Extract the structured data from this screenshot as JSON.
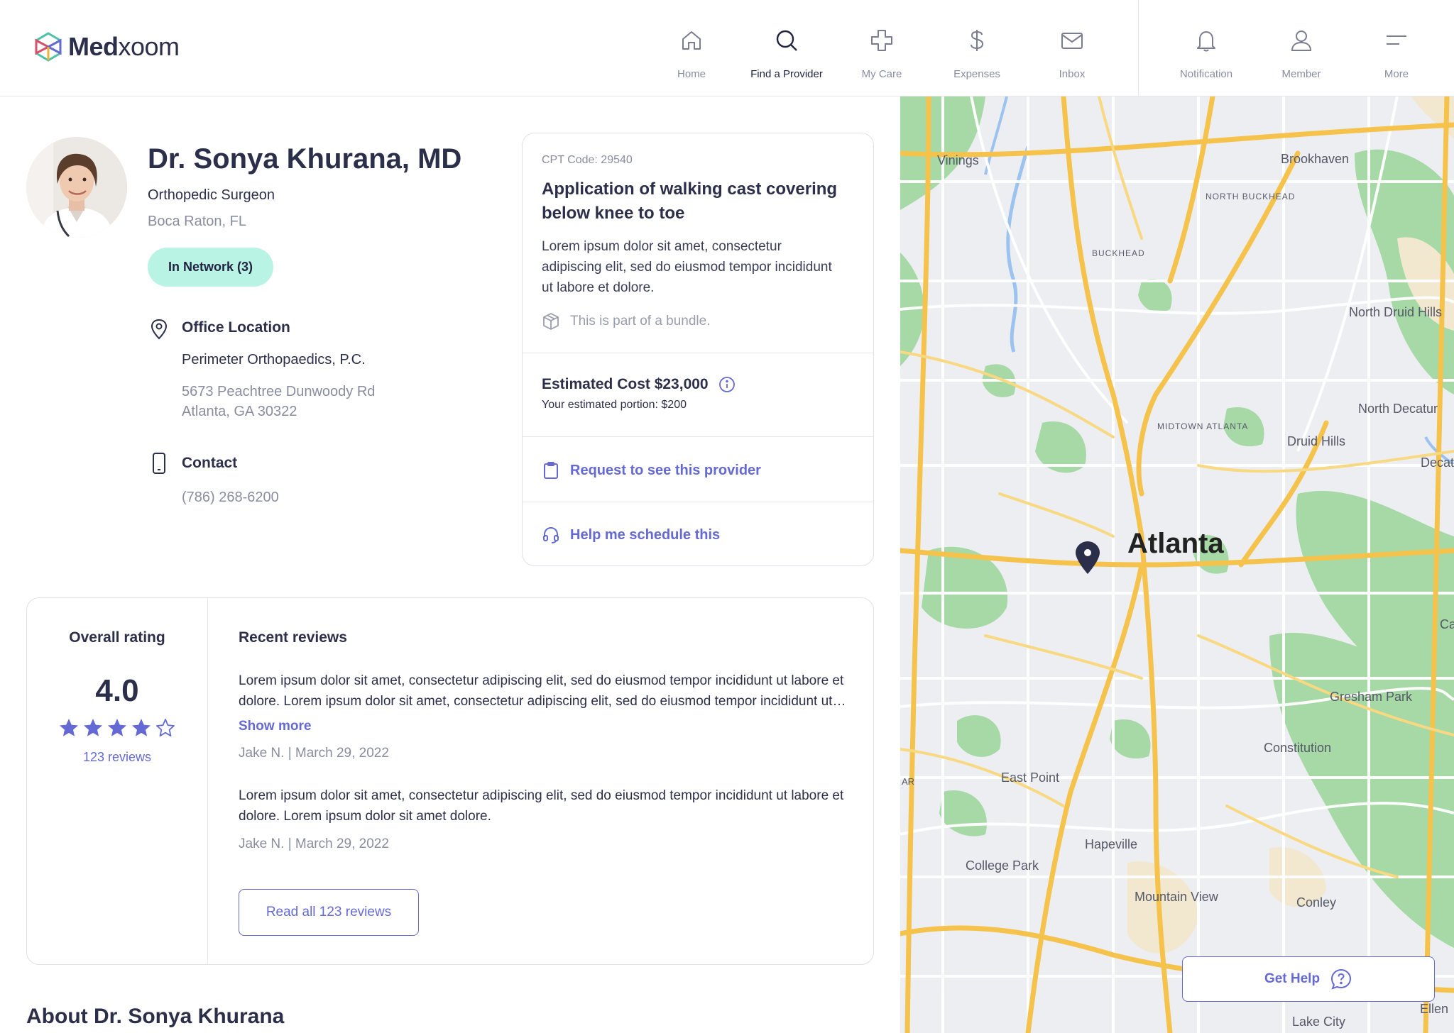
{
  "header": {
    "logo_text_bold": "Med",
    "logo_text_light": "xoom",
    "nav": [
      {
        "label": "Home",
        "icon": "home-icon"
      },
      {
        "label": "Find a Provider",
        "icon": "search-icon"
      },
      {
        "label": "My Care",
        "icon": "cross-icon"
      },
      {
        "label": "Expenses",
        "icon": "dollar-icon"
      },
      {
        "label": "Inbox",
        "icon": "mail-icon"
      }
    ],
    "nav_right": [
      {
        "label": "Notification",
        "icon": "bell-icon"
      },
      {
        "label": "Member",
        "icon": "user-icon"
      },
      {
        "label": "More",
        "icon": "menu-icon"
      }
    ]
  },
  "provider": {
    "name": "Dr. Sonya Khurana, MD",
    "specialty": "Orthopedic Surgeon",
    "city": "Boca Raton, FL",
    "network_badge": "In Network (3)",
    "office_title": "Office Location",
    "office_name": "Perimeter Orthopaedics, P.C.",
    "address_line1": "5673 Peachtree Dunwoody Rd",
    "address_line2": "Atlanta, GA 30322",
    "contact_title": "Contact",
    "phone": "(786) 268-6200"
  },
  "cpt": {
    "code": "CPT Code: 29540",
    "title": "Application of walking cast covering below knee to toe",
    "description": "Lorem ipsum dolor sit amet, consectetur adipiscing elit, sed do eiusmod tempor incididunt ut labore et dolore.",
    "bundle_note": "This is part of a bundle.",
    "estimated_cost": "Estimated Cost $23,000",
    "portion": "Your estimated portion: $200",
    "request_label": "Request to see this provider",
    "schedule_label": "Help me schedule this"
  },
  "reviews": {
    "overall_title": "Overall rating",
    "score": "4.0",
    "rating": 4,
    "max_rating": 5,
    "count_label": "123 reviews",
    "recent_title": "Recent reviews",
    "items": [
      {
        "text": "Lorem ipsum dolor sit amet, consectetur adipiscing elit, sed do eiusmod tempor incididunt ut labore et dolore. Lorem ipsum dolor sit amet, consectetur adipiscing elit, sed do eiusmod tempor incididunt ut labore et dolore.",
        "meta": "Jake N. | March 29, 2022"
      },
      {
        "text": "Lorem ipsum dolor sit amet, consectetur adipiscing elit, sed do eiusmod tempor incididunt ut labore et dolore. Lorem ipsum dolor sit amet dolore.",
        "meta": "Jake N. | March 29, 2022"
      }
    ],
    "show_more": "Show more",
    "read_all": "Read all 123 reviews"
  },
  "about_title": "About Dr. Sonya Khurana",
  "map": {
    "city_label": "Atlanta",
    "labels": {
      "vinings": "Vinings",
      "brookhaven": "Brookhaven",
      "north_buckhead": "NORTH BUCKHEAD",
      "buckhead": "BUCKHEAD",
      "north_druid_hills": "North Druid Hills",
      "north_decatur": "North Decatur",
      "druid_hills": "Druid Hills",
      "decatur": "Decatur",
      "midtown": "MIDTOWN ATLANTA",
      "gresham_park": "Gresham Park",
      "constitution": "Constitution",
      "east_point": "East Point",
      "hapeville": "Hapeville",
      "college_park": "College Park",
      "mountain_view": "Mountain View",
      "conley": "Conley",
      "lake_city": "Lake City",
      "ca": "Ca",
      "ar": "AR",
      "ellen": "Ellen"
    },
    "get_help": "Get Help"
  },
  "colors": {
    "accent": "#6469d3",
    "network_bg": "#b9f3e4",
    "text_dark": "#2c2f4a",
    "text_muted": "#8a8ca0"
  }
}
